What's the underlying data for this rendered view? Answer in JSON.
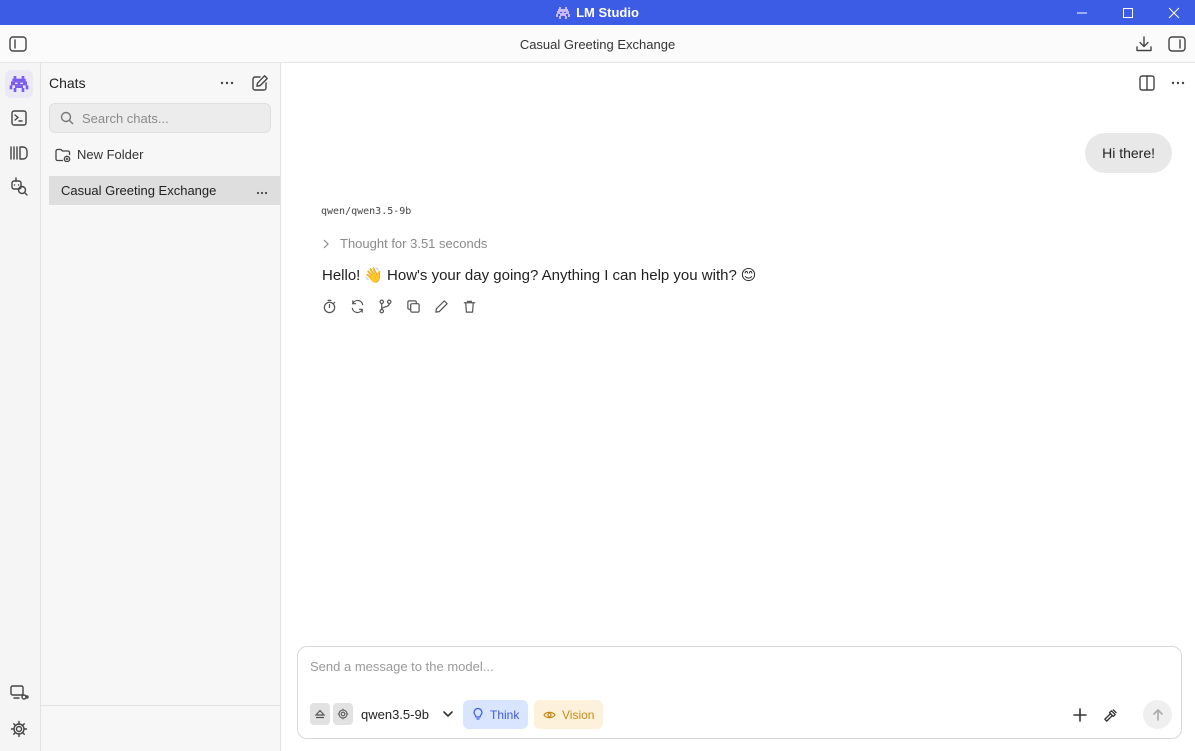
{
  "window": {
    "title": "LM Studio",
    "brand_color": "#3d5ce6"
  },
  "appbar": {
    "chat_title": "Casual Greeting Exchange"
  },
  "sidebar": {
    "heading": "Chats",
    "search_placeholder": "Search chats...",
    "new_folder_label": "New Folder",
    "chats": [
      {
        "title": "Casual Greeting Exchange",
        "selected": true
      }
    ]
  },
  "conversation": {
    "user_message": "Hi there!",
    "model_name": "qwen/qwen3.5-9b",
    "thought_label": "Thought for 3.51 seconds",
    "reply_text_1": "Hello!",
    "reply_emoji_1": "👋",
    "reply_text_2": "How's your day going? Anything I can help you with?",
    "reply_emoji_2": "😊"
  },
  "composer": {
    "placeholder": "Send a message to the model...",
    "model": "qwen3.5-9b",
    "think_label": "Think",
    "vision_label": "Vision"
  }
}
